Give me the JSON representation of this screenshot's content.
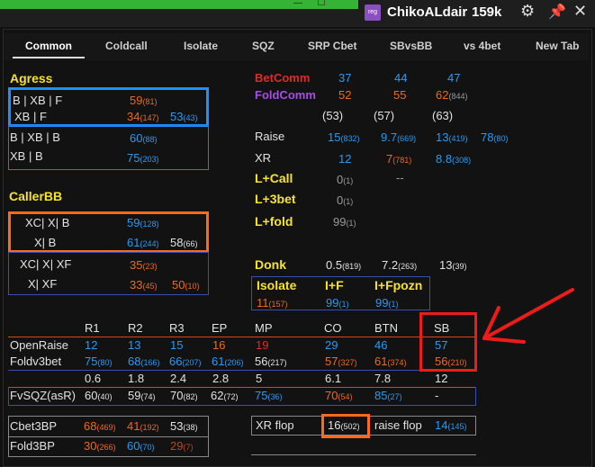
{
  "titlebar": {
    "name": "ChikoALdair",
    "stat": "159k",
    "badge": "reg",
    "min": "—",
    "max": "☐"
  },
  "tabs": [
    "Common",
    "Coldcall",
    "Isolate",
    "SQZ",
    "SRP Cbet",
    "SBvsBB",
    "vs 4bet",
    "New Tab"
  ],
  "agress": {
    "title": "Agress",
    "rows": [
      {
        "label": "B | XB | F",
        "v1": "59",
        "s1": "(81)",
        "v2": "",
        "s2": ""
      },
      {
        "label": "XB | F",
        "v1": "34",
        "s1": "(147)",
        "v2": "53",
        "s2": "(43)"
      },
      {
        "label": "B | XB | B",
        "v1": "60",
        "s1": "(88)",
        "v2": "",
        "s2": ""
      },
      {
        "label": "XB | B",
        "v1": "75",
        "s1": "(203)",
        "v2": "",
        "s2": ""
      }
    ]
  },
  "callerbb": {
    "title": "CallerBB",
    "rows": [
      {
        "label": "XC| X| B",
        "v1": "59",
        "s1": "(128)",
        "v2": "",
        "s2": ""
      },
      {
        "label": "X| B",
        "v1": "61",
        "s1": "(244)",
        "v2": "58",
        "s2": "(66)"
      },
      {
        "label": "XC| X| XF",
        "v1": "35",
        "s1": "(23)",
        "v2": "",
        "s2": ""
      },
      {
        "label": "X| XF",
        "v1": "33",
        "s1": "(45)",
        "v2": "50",
        "s2": "(10)"
      }
    ]
  },
  "betcomm": {
    "label": "BetComm",
    "v": [
      "37",
      "44",
      "47"
    ]
  },
  "foldcomm": {
    "label": "FoldComm",
    "v": [
      "52",
      "55",
      "62"
    ],
    "s3": "(844)"
  },
  "counts": [
    "(53)",
    "(57)",
    "(63)"
  ],
  "raise": {
    "label": "Raise",
    "v": [
      "15",
      "9.7",
      "13",
      "78"
    ],
    "s": [
      "(832)",
      "(669)",
      "(419)",
      "(80)"
    ]
  },
  "xr": {
    "label": "XR",
    "v": [
      "12",
      "7",
      "8.8"
    ],
    "s": [
      "",
      "(781)",
      "(308)"
    ]
  },
  "lcall": {
    "label": "L+Call",
    "v": "0",
    "s": "(1)",
    "v2": "--"
  },
  "l3bet": {
    "label": "L+3bet",
    "v": "0",
    "s": "(1)"
  },
  "lfold": {
    "label": "L+fold",
    "v": "99",
    "s": "(1)"
  },
  "donk": {
    "label": "Donk",
    "v": [
      "0.5",
      "7.2",
      "13"
    ],
    "s": [
      "(819)",
      "(263)",
      "(39)"
    ]
  },
  "iso": {
    "labels": [
      "Isolate",
      "I+F",
      "I+Fpozn"
    ],
    "v": [
      "11",
      "99",
      "99"
    ],
    "s": [
      "(157)",
      "(1)",
      "(1)"
    ]
  },
  "positions": [
    "R1",
    "R2",
    "R3",
    "EP",
    "MP",
    "CO",
    "BTN",
    "SB"
  ],
  "openraise": {
    "label": "OpenRaise",
    "v": [
      "12",
      "13",
      "15",
      "16",
      "19",
      "29",
      "46",
      "57"
    ]
  },
  "foldv3bet": {
    "label": "Foldv3bet",
    "v": [
      "75",
      "68",
      "66",
      "61",
      "56",
      "57",
      "61",
      "56"
    ],
    "s": [
      "(80)",
      "(166)",
      "(207)",
      "(206)",
      "(217)",
      "(327)",
      "(374)",
      "(210)"
    ]
  },
  "ratio": [
    "0.6",
    "1.8",
    "2.4",
    "2.8",
    "5",
    "6.1",
    "7.8",
    "12"
  ],
  "fvsqz": {
    "label": "FvSQZ(asR)",
    "v": [
      "60",
      "59",
      "70",
      "62",
      "75",
      "70",
      "85",
      "-"
    ],
    "s": [
      "(40)",
      "(74)",
      "(82)",
      "(72)",
      "(36)",
      "(54)",
      "(27)",
      ""
    ]
  },
  "cbet3bp": {
    "label": "Cbet3BP",
    "v": [
      "68",
      "41",
      "53"
    ],
    "s": [
      "(469)",
      "(192)",
      "(38)"
    ]
  },
  "fold3bp": {
    "label": "Fold3BP",
    "v": [
      "30",
      "60",
      "29"
    ],
    "s": [
      "(266)",
      "(70)",
      "(7)"
    ]
  },
  "xrflop": {
    "label": "XR flop",
    "v": "16",
    "s": "(502)"
  },
  "raiseflop": {
    "label": "raise flop",
    "v": "14",
    "s": "(145)"
  }
}
